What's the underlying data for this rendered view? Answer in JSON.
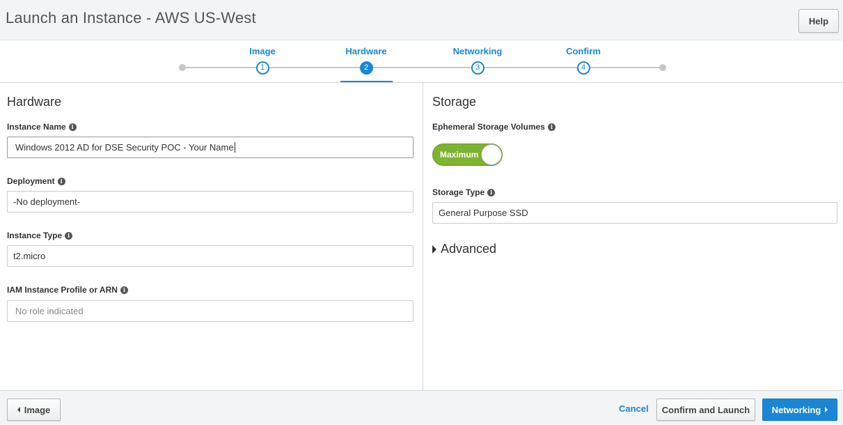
{
  "header": {
    "title": "Launch an Instance - AWS US-West",
    "help_label": "Help"
  },
  "wizard": {
    "steps": [
      {
        "label": "Image",
        "number": "1"
      },
      {
        "label": "Hardware",
        "number": "2"
      },
      {
        "label": "Networking",
        "number": "3"
      },
      {
        "label": "Confirm",
        "number": "4"
      }
    ],
    "active_step": 2,
    "accent_color": "#1a87d6"
  },
  "hardware": {
    "section_title": "Hardware",
    "instance_name": {
      "label": "Instance Name",
      "value": "Windows 2012 AD for DSE Security POC - Your Name"
    },
    "deployment": {
      "label": "Deployment",
      "value": "-No deployment-"
    },
    "instance_type": {
      "label": "Instance Type",
      "value": "t2.micro"
    },
    "iam_profile": {
      "label": "IAM Instance Profile or ARN",
      "placeholder": "No role indicated"
    }
  },
  "storage": {
    "section_title": "Storage",
    "ephemeral": {
      "label": "Ephemeral Storage Volumes",
      "toggle_label": "Maximum",
      "toggle_on": true,
      "toggle_color": "#7fb230"
    },
    "storage_type": {
      "label": "Storage Type",
      "value": "General Purpose SSD"
    },
    "advanced_label": "Advanced"
  },
  "footer": {
    "back_label": "Image",
    "cancel_label": "Cancel",
    "confirm_label": "Confirm and Launch",
    "next_label": "Networking"
  },
  "icons": [
    "info-icon",
    "triangle-right-icon",
    "chevron-left-icon",
    "chevron-right-icon"
  ]
}
